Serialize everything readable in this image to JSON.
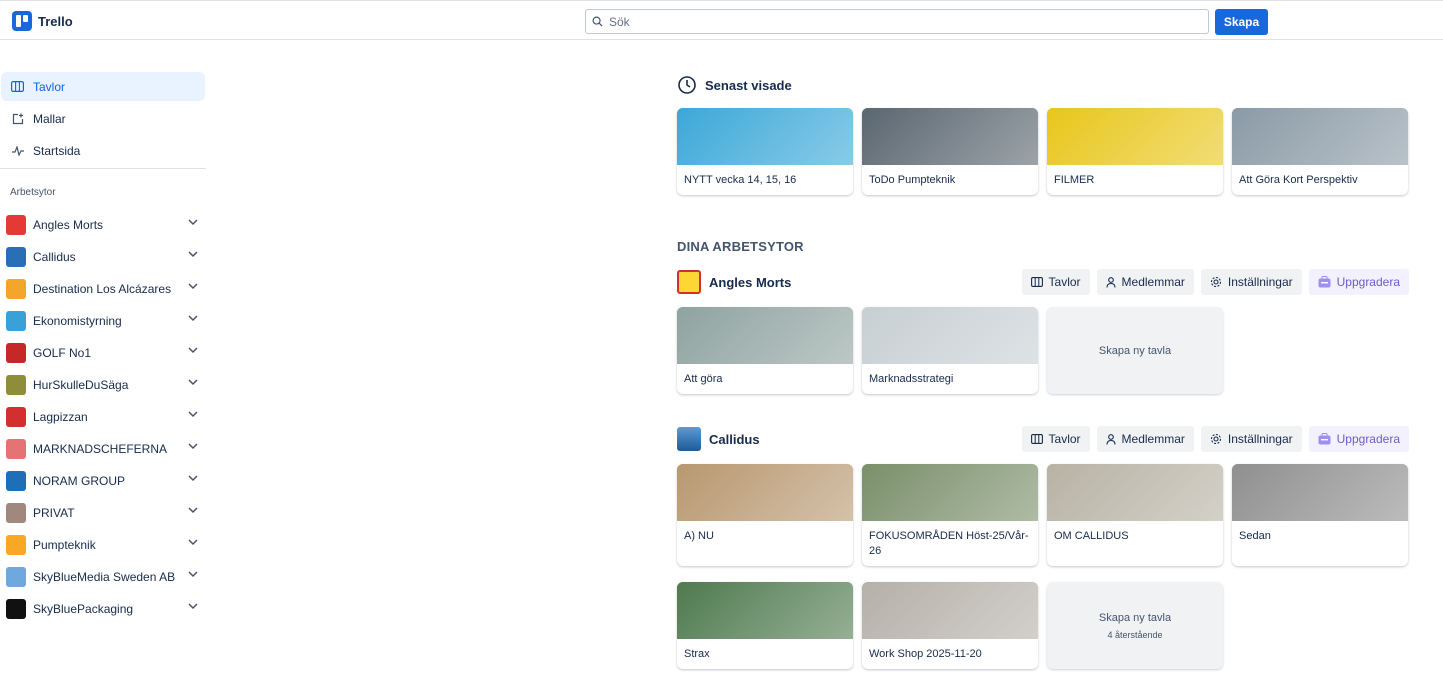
{
  "app": {
    "name": "Trello"
  },
  "header": {
    "search_placeholder": "Sök",
    "create_label": "Skapa"
  },
  "sidebar": {
    "nav": [
      {
        "label": "Tavlor",
        "icon": "board-icon",
        "active": true
      },
      {
        "label": "Mallar",
        "icon": "template-icon",
        "active": false
      },
      {
        "label": "Startsida",
        "icon": "activity-icon",
        "active": false
      }
    ],
    "workspaces_heading": "Arbetsytor",
    "workspaces": [
      {
        "label": "Angles Morts",
        "color": "#e53935"
      },
      {
        "label": "Callidus",
        "color": "#2a6fb5"
      },
      {
        "label": "Destination Los Alcázares",
        "color": "#f4a62a"
      },
      {
        "label": "Ekonomistyrning",
        "color": "#3aa0d8"
      },
      {
        "label": "GOLF No1",
        "color": "#c62828"
      },
      {
        "label": "HurSkulleDuSäga",
        "color": "#8d8d3a"
      },
      {
        "label": "Lagpizzan",
        "color": "#d32f2f"
      },
      {
        "label": "MARKNADSCHEFERNA",
        "color": "#e57373"
      },
      {
        "label": "NORAM GROUP",
        "color": "#1e6fb8"
      },
      {
        "label": "PRIVAT",
        "color": "#a1887f"
      },
      {
        "label": "Pumpteknik",
        "color": "#f9a825"
      },
      {
        "label": "SkyBlueMedia Sweden AB",
        "color": "#6fa8dc"
      },
      {
        "label": "SkyBluePackaging",
        "color": "#111111"
      }
    ]
  },
  "recent": {
    "title": "Senast visade",
    "boards": [
      {
        "name": "NYTT vecka 14, 15, 16",
        "color": "#3ba8d8"
      },
      {
        "name": "ToDo Pumpteknik",
        "color": "#5a6670"
      },
      {
        "name": "FILMER",
        "color": "#e8c61a"
      },
      {
        "name": "Att Göra Kort Perspektiv",
        "color": "#8a9aa6"
      }
    ]
  },
  "workspaces_section": {
    "title": "DINA ARBETSYTOR",
    "buttons": {
      "boards": "Tavlor",
      "members": "Medlemmar",
      "settings": "Inställningar",
      "upgrade": "Uppgradera"
    },
    "angles": {
      "name": "Angles Morts",
      "boards": [
        {
          "name": "Att göra",
          "color": "#8fa3a0"
        },
        {
          "name": "Marknadsstrategi",
          "color": "#c7cfd3"
        }
      ],
      "new_board": "Skapa ny tavla"
    },
    "callidus": {
      "name": "Callidus",
      "boards": [
        {
          "name": "A) NU",
          "color": "#b89870"
        },
        {
          "name": "FOKUSOMRÅDEN Höst-25/Vår-26",
          "color": "#7a8f6a"
        },
        {
          "name": "OM CALLIDUS",
          "color": "#b7b2a4"
        },
        {
          "name": "Sedan",
          "color": "#8f8f8f"
        },
        {
          "name": "Strax",
          "color": "#4f7a4f"
        },
        {
          "name": "Work Shop 2025-11-20",
          "color": "#b5b0a8"
        }
      ],
      "new_board": "Skapa ny tavla",
      "remaining": "4 återstående"
    }
  }
}
